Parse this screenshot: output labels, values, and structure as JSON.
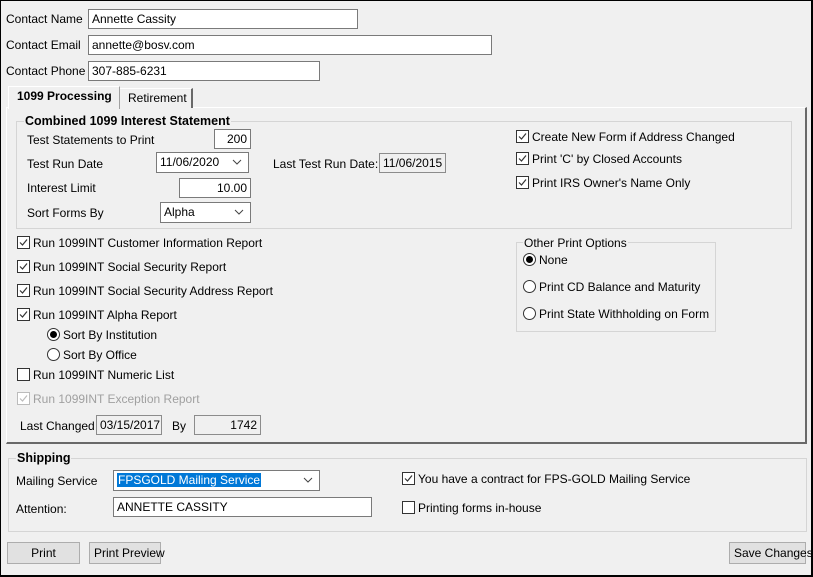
{
  "contact": {
    "name_label": "Contact Name",
    "name_value": "Annette Cassity",
    "email_label": "Contact Email",
    "email_value": "annette@bosv.com",
    "phone_label": "Contact Phone",
    "phone_value": "307-885-6231"
  },
  "tabs": [
    {
      "label": "1099 Processing",
      "active": true
    },
    {
      "label": "Retirement",
      "active": false
    }
  ],
  "combined_statement": {
    "title": "Combined 1099 Interest Statement",
    "test_statements_label": "Test Statements to Print",
    "test_statements_value": "200",
    "test_run_date_label": "Test Run Date",
    "test_run_date_value": "11/06/2020",
    "last_test_run_label": "Last Test Run Date:",
    "last_test_run_value": "11/06/2015",
    "interest_limit_label": "Interest Limit",
    "interest_limit_value": "10.00",
    "sort_forms_label": "Sort Forms By",
    "sort_forms_value": "Alpha",
    "options": [
      {
        "label": "Create New Form if Address Changed",
        "checked": true
      },
      {
        "label": "Print 'C' by Closed Accounts",
        "checked": true
      },
      {
        "label": "Print IRS Owner's Name Only",
        "checked": true
      }
    ]
  },
  "reports": [
    {
      "label": "Run 1099INT Customer Information Report",
      "checked": true,
      "disabled": false
    },
    {
      "label": "Run 1099INT Social Security Report",
      "checked": true,
      "disabled": false
    },
    {
      "label": "Run 1099INT Social Security Address Report",
      "checked": true,
      "disabled": false
    },
    {
      "label": "Run 1099INT Alpha Report",
      "checked": true,
      "disabled": false
    }
  ],
  "alpha_sort": [
    {
      "label": "Sort By Institution",
      "selected": true
    },
    {
      "label": "Sort By Office",
      "selected": false
    }
  ],
  "numeric_list": {
    "label": "Run 1099INT Numeric List",
    "checked": false
  },
  "exception_report": {
    "label": "Run 1099INT Exception Report",
    "checked": true,
    "disabled": true
  },
  "last_changed": {
    "label": "Last Changed",
    "date": "03/15/2017",
    "by_label": "By",
    "by_value": "1742"
  },
  "other_print_options": {
    "title": "Other Print Options",
    "options": [
      {
        "label": "None",
        "selected": true
      },
      {
        "label": "Print CD Balance and Maturity",
        "selected": false
      },
      {
        "label": "Print State Withholding on Form",
        "selected": false
      }
    ]
  },
  "shipping": {
    "title": "Shipping",
    "mailing_service_label": "Mailing Service",
    "mailing_service_value": "FPSGOLD Mailing Service",
    "attention_label": "Attention:",
    "attention_value": "ANNETTE CASSITY",
    "contract": {
      "label": "You have a contract for FPS-GOLD Mailing Service",
      "checked": true
    },
    "inhouse": {
      "label": "Printing forms in-house",
      "checked": false
    }
  },
  "buttons": {
    "print": "Print",
    "print_preview": "Print Preview",
    "save_changes": "Save Changes"
  },
  "colors": {
    "selection": "#0078d7",
    "background": "#f0f0f0"
  }
}
